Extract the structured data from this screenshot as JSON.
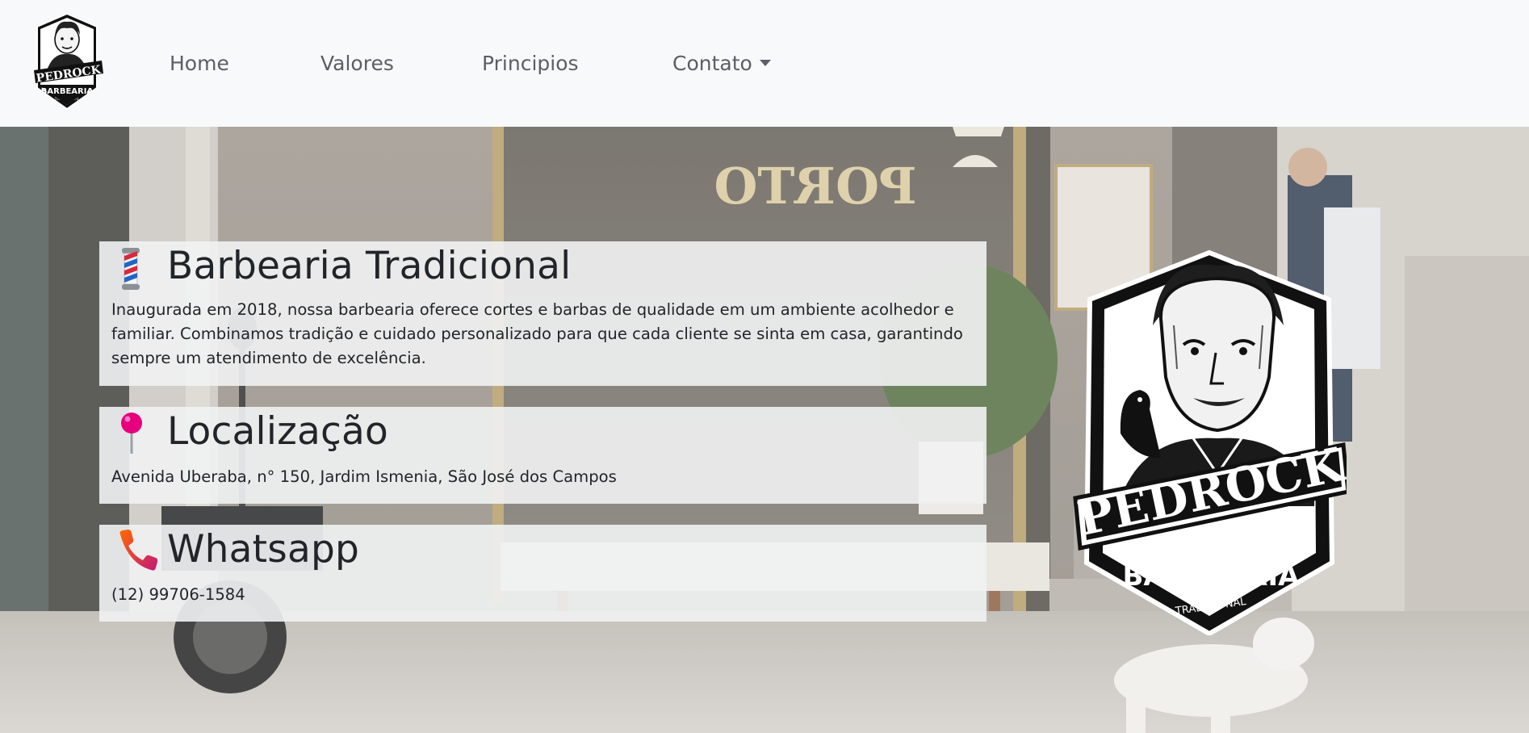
{
  "navbar": {
    "logo": {
      "icon": "pedrock-barbearia-logo",
      "text_top": "PEDROCK",
      "text_mid": "BARBEARIA",
      "text_bottom": "TRADICIONAL"
    },
    "links": [
      {
        "label": "Home"
      },
      {
        "label": "Valores"
      },
      {
        "label": "Principios"
      },
      {
        "label": "Contato",
        "dropdown": true
      }
    ]
  },
  "hero": {
    "background": "barbershop-storefront-photo",
    "storefront_sign": "PORTO",
    "cards": [
      {
        "icon": "barber-pole-icon",
        "title": "Barbearia Tradicional",
        "text": "Inaugurada em 2018, nossa barbearia oferece cortes e barbas de qualidade em um ambiente acolhedor e familiar. Combinamos tradição e cuidado personalizado para que cada cliente se sinta em casa, garantindo sempre um atendimento de excelência."
      },
      {
        "icon": "round-pushpin-icon",
        "title": "Localização",
        "text": "Avenida Uberaba, n° 150, Jardim Ismenia, São José dos Campos"
      },
      {
        "icon": "telephone-receiver-icon",
        "title": "Whatsapp",
        "text": "(12) 99706-1584"
      }
    ],
    "logo": {
      "icon": "pedrock-barbearia-logo",
      "text_top": "PEDROCK",
      "text_mid": "BARBEARIA",
      "text_bottom": "TRADICIONAL"
    }
  },
  "colors": {
    "navbar_bg": "#f8f9fa",
    "nav_text": "#5a5f66",
    "card_bg": "#f1f2f3",
    "text": "#212529",
    "pin": "#e6007e",
    "phone_start": "#ff6a00",
    "phone_end": "#c2187a"
  }
}
